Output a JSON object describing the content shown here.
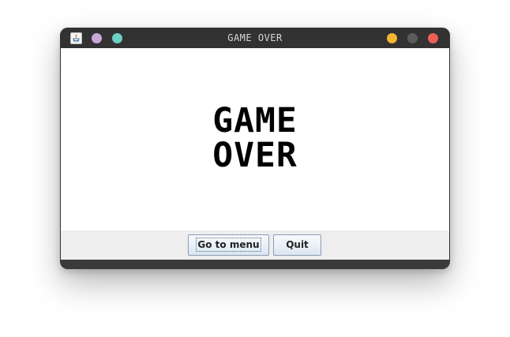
{
  "window": {
    "title": "GAME OVER",
    "controls_left": [
      "lilac",
      "teal"
    ],
    "controls_right": [
      "minimize",
      "maximize",
      "close"
    ],
    "colors": {
      "titlebar": "#323232",
      "lilac": "#c9a7d9",
      "teal": "#6ecfc4",
      "amber": "#f5b630",
      "gray": "#5b5b5b",
      "red": "#ed5f57"
    },
    "app_icon": "java-icon"
  },
  "main": {
    "line1": "GAME",
    "line2": "OVER"
  },
  "buttons": {
    "menu_label": "Go to menu",
    "quit_label": "Quit"
  }
}
